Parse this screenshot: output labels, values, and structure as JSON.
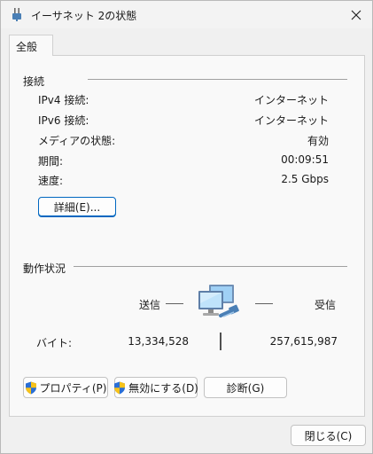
{
  "window": {
    "title": "イーサネット 2の状態",
    "close_label": "閉じる(C)"
  },
  "tabs": [
    {
      "label": "全般"
    }
  ],
  "connection": {
    "title": "接続",
    "rows": [
      {
        "label": "IPv4 接続:",
        "value": "インターネット"
      },
      {
        "label": "IPv6 接続:",
        "value": "インターネット"
      },
      {
        "label": "メディアの状態:",
        "value": "有効"
      },
      {
        "label": "期間:",
        "value": "00:09:51"
      },
      {
        "label": "速度:",
        "value": "2.5 Gbps"
      }
    ],
    "details_button": "詳細(E)..."
  },
  "activity": {
    "title": "動作状況",
    "sent_label": "送信",
    "received_label": "受信",
    "bytes_label": "バイト:",
    "bytes_sent": "13,334,528",
    "bytes_received": "257,615,987"
  },
  "actions": {
    "properties_button": "プロパティ(P)",
    "disable_button": "無効にする(D)",
    "diagnose_button": "診断(G)"
  },
  "icons": {
    "app": "network-adapter-icon",
    "network": "network-computers-icon",
    "shield": "uac-shield-icon"
  },
  "colors": {
    "accent": "#0067c0",
    "window_bg": "#f0f0f0",
    "panel_bg": "#f9f9f9"
  }
}
